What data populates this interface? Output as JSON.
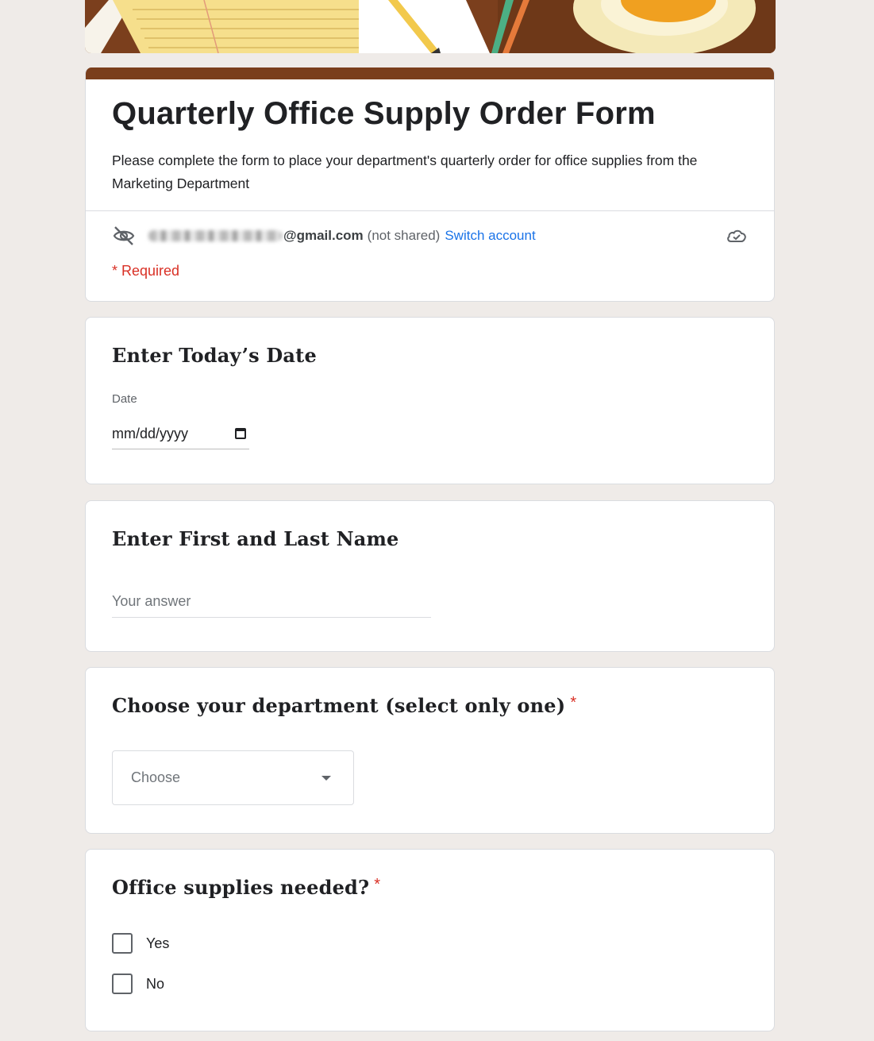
{
  "header": {
    "title": "Quarterly Office Supply Order Form",
    "description": "Please complete the form to place your department's quarterly order for office supplies from the Marketing Department",
    "email_suffix": "@gmail.com",
    "not_shared": "(not shared)",
    "switch_account": "Switch account",
    "required_note": "* Required"
  },
  "questions": {
    "date": {
      "title": "Enter Today’s Date",
      "label": "Date",
      "placeholder": "mm/dd/yyyy"
    },
    "name": {
      "title": "Enter First and Last Name",
      "placeholder": "Your answer"
    },
    "department": {
      "title": "Choose your department (select only one)",
      "required_mark": "*",
      "selected": "Choose"
    },
    "supplies": {
      "title": "Office supplies needed?",
      "required_mark": "*",
      "options": [
        "Yes",
        "No"
      ]
    }
  },
  "colors": {
    "accent": "#7a3e1c",
    "background": "#efebe8",
    "link": "#1a73e8",
    "required": "#d93025"
  },
  "icons": {
    "visibility": "eye-off-icon",
    "cloud": "cloud-check-icon",
    "calendar": "calendar-icon",
    "dropdown": "arrow-drop-down-icon"
  }
}
